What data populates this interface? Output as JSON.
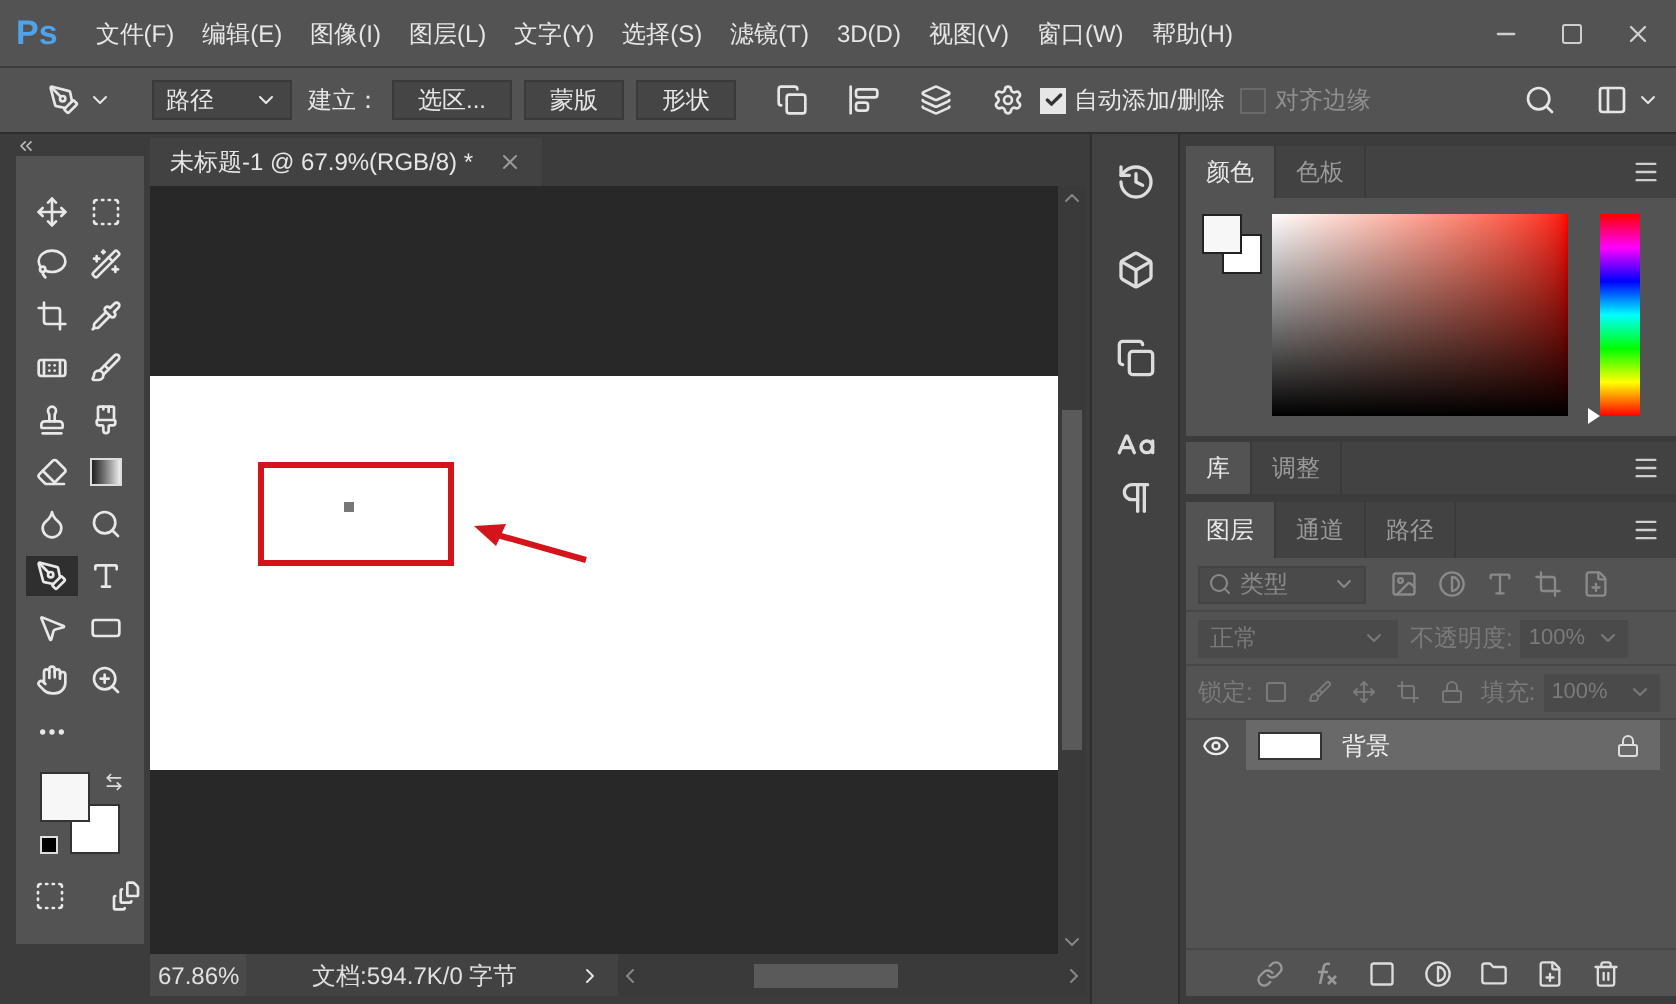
{
  "app": {
    "logo": "Ps"
  },
  "menu": [
    "文件(F)",
    "编辑(E)",
    "图像(I)",
    "图层(L)",
    "文字(Y)",
    "选择(S)",
    "滤镜(T)",
    "3D(D)",
    "视图(V)",
    "窗口(W)",
    "帮助(H)"
  ],
  "options_bar": {
    "mode": "路径",
    "make_label": "建立：",
    "buttons": [
      "选区...",
      "蒙版",
      "形状"
    ],
    "checkboxes": [
      {
        "label": "自动添加/删除",
        "checked": true,
        "disabled": false
      },
      {
        "label": "对齐边缘",
        "checked": false,
        "disabled": true
      }
    ]
  },
  "tools": [
    {
      "kind": "move",
      "selected": false
    },
    {
      "kind": "marquee",
      "selected": false
    },
    {
      "kind": "lasso",
      "selected": false
    },
    {
      "kind": "quick-select",
      "selected": false
    },
    {
      "kind": "crop",
      "selected": false
    },
    {
      "kind": "eyedropper",
      "selected": false
    },
    {
      "kind": "healing",
      "selected": false
    },
    {
      "kind": "brush",
      "selected": false
    },
    {
      "kind": "stamp",
      "selected": false
    },
    {
      "kind": "history-brush",
      "selected": false
    },
    {
      "kind": "eraser",
      "selected": false
    },
    {
      "kind": "gradient",
      "selected": false
    },
    {
      "kind": "blur",
      "selected": false
    },
    {
      "kind": "dodge",
      "selected": false
    },
    {
      "kind": "pen",
      "selected": true
    },
    {
      "kind": "type",
      "selected": false
    },
    {
      "kind": "path-select",
      "selected": false
    },
    {
      "kind": "shape",
      "selected": false
    },
    {
      "kind": "hand",
      "selected": false
    },
    {
      "kind": "zoom",
      "selected": false
    },
    {
      "kind": "more",
      "selected": false
    }
  ],
  "document": {
    "tab_title": "未标题-1 @ 67.9%(RGB/8) *",
    "zoom": "67.86%",
    "doc_info": "文档:594.7K/0 字节"
  },
  "color_panel": {
    "tabs": [
      {
        "label": "颜色",
        "selected": true
      },
      {
        "label": "色板",
        "selected": false
      }
    ],
    "hue_slider": {
      "level": 0
    }
  },
  "library_panel": {
    "tabs": [
      {
        "label": "库",
        "selected": true
      },
      {
        "label": "调整",
        "selected": false
      }
    ]
  },
  "layers_panel": {
    "tabs": [
      {
        "label": "图层",
        "selected": true
      },
      {
        "label": "通道",
        "selected": false
      },
      {
        "label": "路径",
        "selected": false
      }
    ],
    "filter": "类型",
    "blend_mode": "正常",
    "opacity_label": "不透明度:",
    "opacity": "100%",
    "lock_label": "锁定:",
    "fill_label": "填充:",
    "fill": "100%",
    "layers": [
      {
        "name": "背景",
        "visible": true,
        "locked": true,
        "selected": true
      }
    ]
  }
}
